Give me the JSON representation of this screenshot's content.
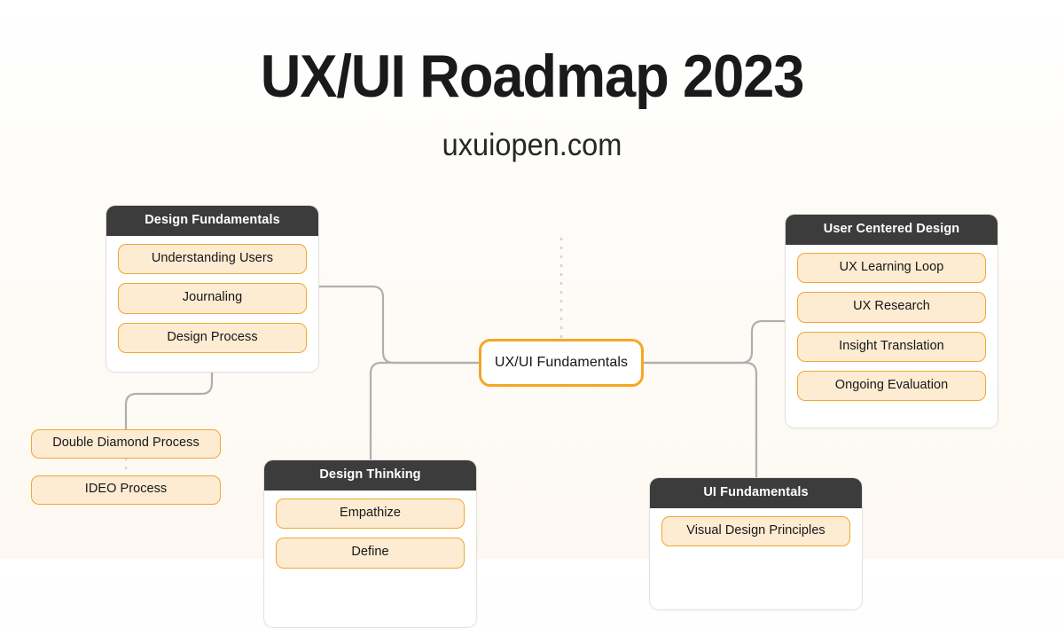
{
  "header": {
    "title": "UX/UI Roadmap 2023",
    "subtitle": "uxuiopen.com"
  },
  "hub": {
    "label": "UX/UI Fundamentals"
  },
  "cards": [
    {
      "id": "design-fundamentals",
      "title": "Design Fundamentals",
      "items": [
        "Understanding Users",
        "Journaling",
        "Design Process"
      ]
    },
    {
      "id": "user-centered-design",
      "title": "User Centered Design",
      "items": [
        "UX Learning Loop",
        "UX Research",
        "Insight Translation",
        "Ongoing Evaluation"
      ]
    },
    {
      "id": "design-thinking",
      "title": "Design Thinking",
      "items": [
        "Empathize",
        "Define"
      ]
    },
    {
      "id": "ui-fundamentals",
      "title": "UI Fundamentals",
      "items": [
        "Visual Design Principles"
      ]
    }
  ],
  "standalone_nodes": [
    {
      "id": "double-diamond-process",
      "label": "Double Diamond Process"
    },
    {
      "id": "ideo-process",
      "label": "IDEO Process"
    }
  ],
  "colors": {
    "accent": "#F5A623",
    "pill_fill": "#FDEBD2",
    "pill_border": "#F0A830",
    "card_header": "#3C3C3C",
    "card_body": "#FFFFFF",
    "connector": "#AFAFAF",
    "text": "#171717",
    "background_top": "#FFFFFF",
    "background_bottom": "#FDF8F1"
  }
}
